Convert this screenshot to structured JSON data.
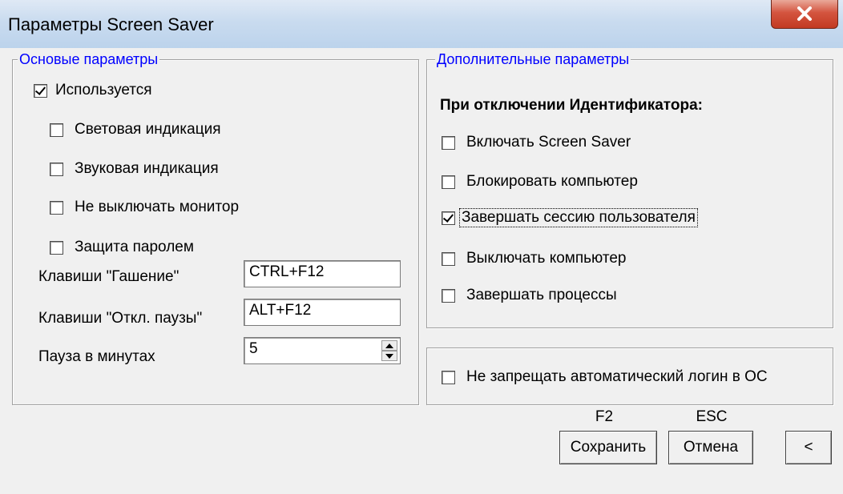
{
  "window": {
    "title": "Параметры Screen Saver"
  },
  "basic": {
    "legend": "Основые параметры",
    "used": {
      "label": "Используется",
      "checked": true
    },
    "options": [
      {
        "label": "Световая индикация",
        "checked": false
      },
      {
        "label": "Звуковая индикация",
        "checked": false
      },
      {
        "label": "Не выключать монитор",
        "checked": false
      },
      {
        "label": "Защита паролем",
        "checked": false
      }
    ],
    "fields": {
      "blank_label": "Клавиши \"Гашение\"",
      "blank_value": "CTRL+F12",
      "pause_key_label": "Клавиши \"Откл. паузы\"",
      "pause_key_value": "ALT+F12",
      "pause_minutes_label": "Пауза в минутах",
      "pause_minutes_value": "5"
    }
  },
  "extra": {
    "legend": "Дополнительные параметры",
    "heading": "При отключении Идентификатора:",
    "options": [
      {
        "label": "Включать Screen Saver",
        "checked": false
      },
      {
        "label": "Блокировать компьютер",
        "checked": false
      },
      {
        "label": "Завершать сессию пользователя",
        "checked": true
      },
      {
        "label": "Выключать компьютер",
        "checked": false
      },
      {
        "label": "Завершать процессы",
        "checked": false
      }
    ]
  },
  "autologin": {
    "label": "Не запрещать автоматический логин в ОС",
    "checked": false
  },
  "buttons": {
    "save_key": "F2",
    "save_label": "Сохранить",
    "cancel_key": "ESC",
    "cancel_label": "Отмена",
    "collapse_label": "<"
  }
}
